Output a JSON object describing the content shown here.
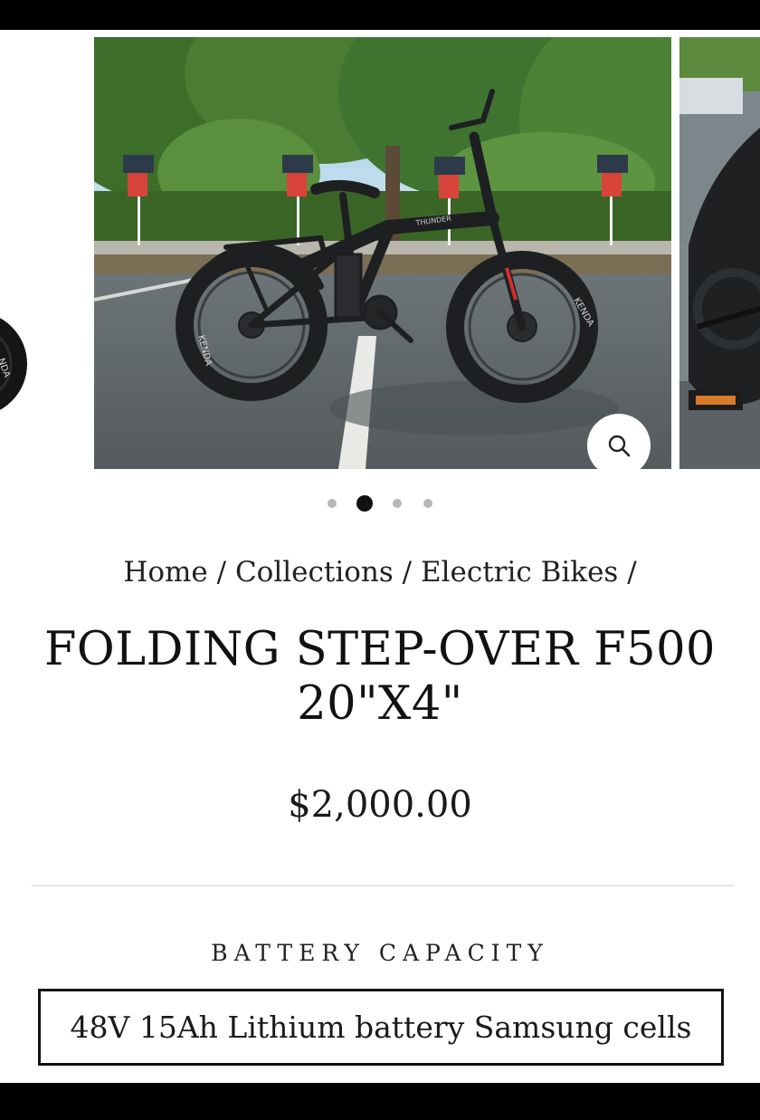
{
  "gallery": {
    "total_slides": 4,
    "active_slide": 2,
    "zoom_icon": "search-icon",
    "main_image_subject": "bike-photo"
  },
  "breadcrumb": {
    "home": "Home",
    "sep1": "/",
    "collections": "Collections",
    "sep2": "/",
    "category": "Electric Bikes",
    "sep3": "/"
  },
  "product": {
    "title_line1": "FOLDING STEP-OVER F500",
    "title_line2": "20\"X4\"",
    "price": "$2,000.00"
  },
  "option": {
    "label": "BATTERY CAPACITY",
    "selected_value": "48V 15Ah Lithium battery Samsung cells"
  },
  "colors": {
    "accent": "#111111",
    "dot_inactive": "#b8b8b8",
    "divider": "#e2e2e2"
  }
}
